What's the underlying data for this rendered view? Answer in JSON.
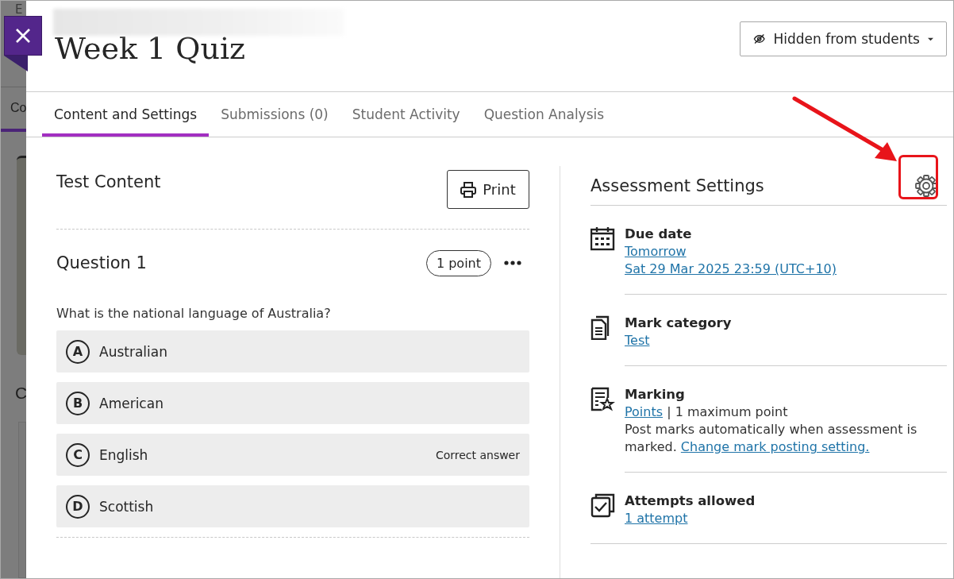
{
  "background_page": {
    "top_text": "E",
    "tab": "Co",
    "heading": "C"
  },
  "title": "Week 1 Quiz",
  "visibility_menu": {
    "label": "Hidden from students"
  },
  "tabs": [
    {
      "label": "Content and Settings",
      "selected": true
    },
    {
      "label": "Submissions (0)",
      "selected": false
    },
    {
      "label": "Student Activity",
      "selected": false
    },
    {
      "label": "Question Analysis",
      "selected": false
    }
  ],
  "test_content": {
    "heading": "Test Content",
    "print_button": "Print",
    "questions": [
      {
        "title": "Question 1",
        "points": "1 point",
        "text": "What is the national language of Australia?",
        "answers": [
          {
            "letter": "A",
            "text": "Australian"
          },
          {
            "letter": "B",
            "text": "American"
          },
          {
            "letter": "C",
            "text": "English",
            "note": "Correct answer"
          },
          {
            "letter": "D",
            "text": "Scottish"
          }
        ]
      }
    ]
  },
  "assessment_settings": {
    "heading": "Assessment Settings",
    "items": [
      {
        "kind": "due_date",
        "label": "Due date",
        "lines": [
          [
            {
              "text": "Tomorrow",
              "link": true
            }
          ],
          [
            {
              "text": "Sat 29 Mar 2025 23:59 (UTC+10)",
              "link": true
            }
          ]
        ]
      },
      {
        "kind": "mark_category",
        "label": "Mark category",
        "lines": [
          [
            {
              "text": "Test",
              "link": true
            }
          ]
        ]
      },
      {
        "kind": "marking",
        "label": "Marking",
        "lines": [
          [
            {
              "text": "Points",
              "link": true
            },
            {
              "text": " | 1 maximum point",
              "link": false
            }
          ],
          [
            {
              "text": "Post marks automatically when assessment is marked. ",
              "link": false
            },
            {
              "text": "Change mark posting setting.",
              "link": true
            }
          ]
        ]
      },
      {
        "kind": "attempts",
        "label": "Attempts allowed",
        "lines": [
          [
            {
              "text": "1 attempt",
              "link": true
            }
          ]
        ]
      }
    ]
  }
}
